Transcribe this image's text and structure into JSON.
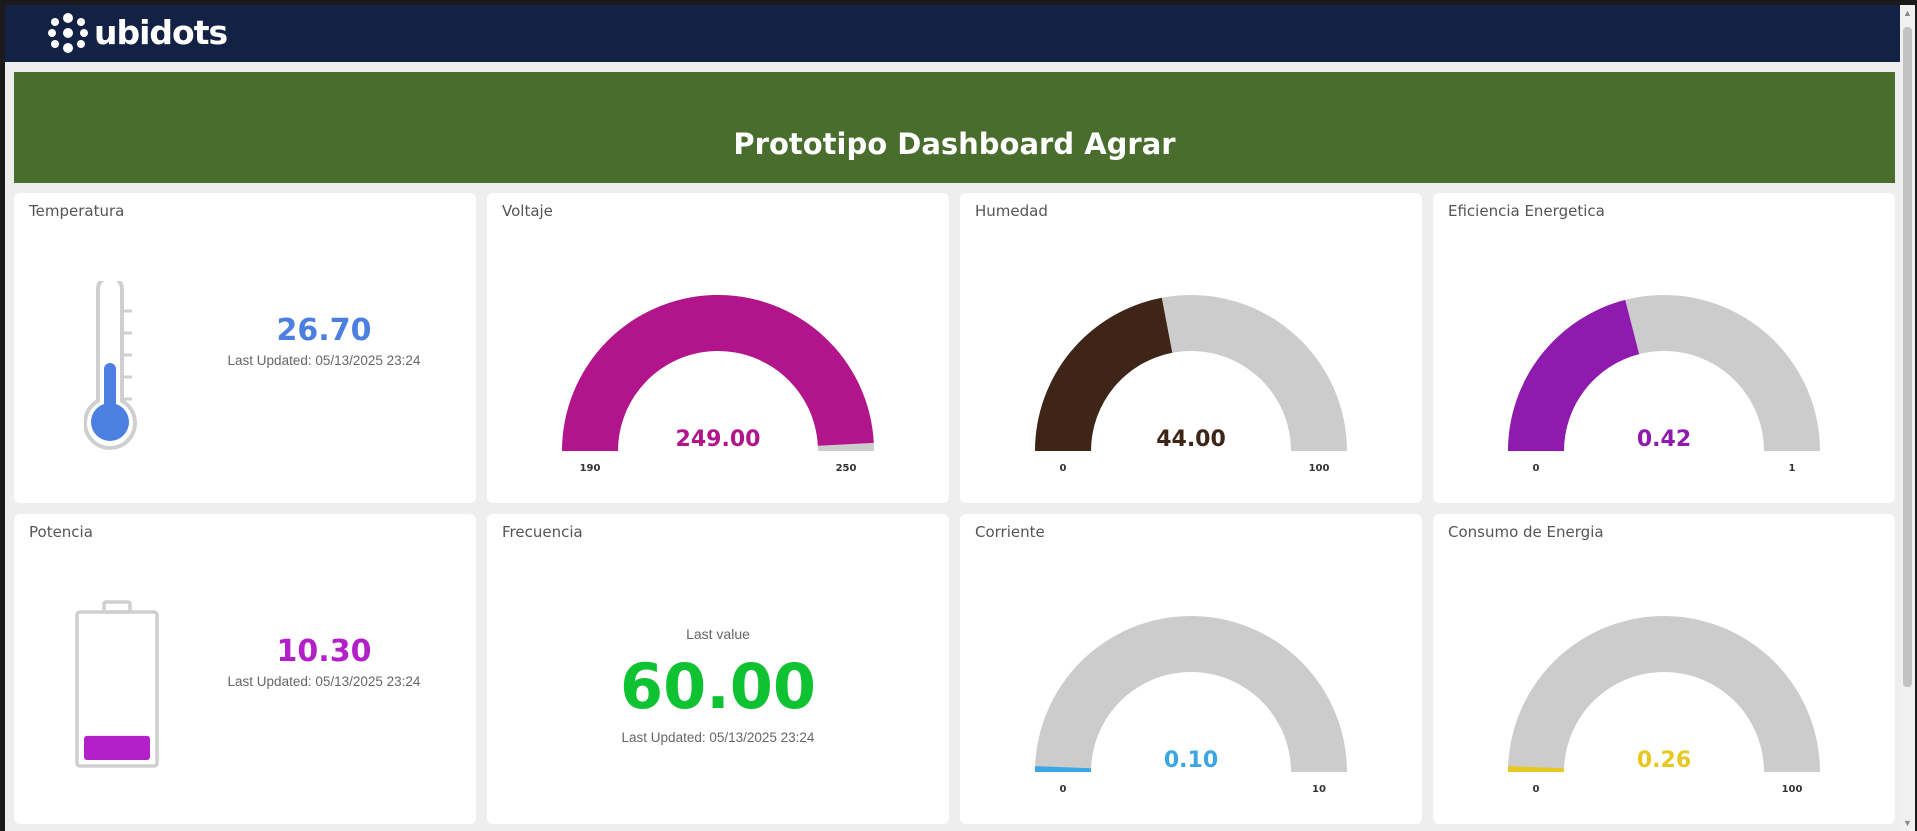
{
  "app": {
    "brand": "ubidots"
  },
  "banner": {
    "title": "Prototipo Dashboard Agrar"
  },
  "widgets": {
    "temperatura": {
      "title": "Temperatura",
      "value": "26.70",
      "updated": "Last Updated: 05/13/2025 23:24",
      "color": "#4b7fe0"
    },
    "voltaje": {
      "title": "Voltaje",
      "value": "249.00",
      "value_num": 249,
      "min": "190",
      "max": "250",
      "min_num": 190,
      "max_num": 250,
      "color": "#b2158b"
    },
    "humedad": {
      "title": "Humedad",
      "value": "44.00",
      "value_num": 44,
      "min": "0",
      "max": "100",
      "min_num": 0,
      "max_num": 100,
      "color": "#3f2418"
    },
    "eficiencia": {
      "title": "Eficiencia Energetica",
      "value": "0.42",
      "value_num": 0.42,
      "min": "0",
      "max": "1",
      "min_num": 0,
      "max_num": 1,
      "color": "#8e1bad"
    },
    "potencia": {
      "title": "Potencia",
      "value": "10.30",
      "updated": "Last Updated: 05/13/2025 23:24",
      "color": "#b31fc9",
      "level": 0.17
    },
    "frecuencia": {
      "title": "Frecuencia",
      "caption": "Last value",
      "value": "60.00",
      "updated": "Last Updated: 05/13/2025 23:24",
      "color": "#0fc232"
    },
    "corriente": {
      "title": "Corriente",
      "value": "0.10",
      "value_num": 0.1,
      "min": "0",
      "max": "10",
      "min_num": 0,
      "max_num": 10,
      "color": "#3aa6e3"
    },
    "consumo": {
      "title": "Consumo de Energia",
      "value": "0.26",
      "value_num": 0.26,
      "min": "0",
      "max": "100",
      "min_num": 0,
      "max_num": 100,
      "color": "#e8c820"
    }
  },
  "colors": {
    "topbar": "#132145",
    "banner": "#496d2c",
    "gauge_track": "#cccccc"
  },
  "icons": {
    "brand": "ubidots-logo-icon",
    "thermometer": "thermometer-icon",
    "battery": "battery-icon"
  }
}
